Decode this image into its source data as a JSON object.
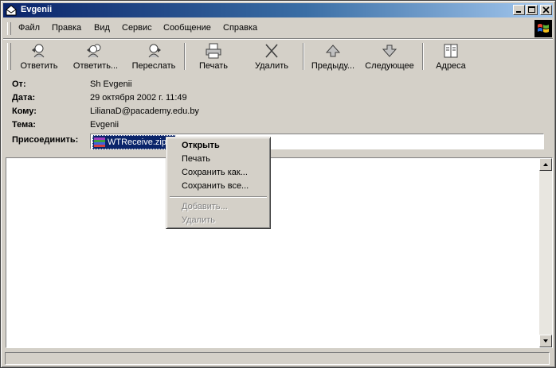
{
  "window": {
    "title": "Evgenii"
  },
  "menu": [
    "Файл",
    "Правка",
    "Вид",
    "Сервис",
    "Сообщение",
    "Справка"
  ],
  "toolbar": [
    {
      "label": "Ответить",
      "icon": "reply-icon"
    },
    {
      "label": "Ответить...",
      "icon": "reply-all-icon"
    },
    {
      "label": "Переслать",
      "icon": "forward-icon"
    },
    {
      "label": "Печать",
      "icon": "print-icon"
    },
    {
      "label": "Удалить",
      "icon": "delete-icon"
    },
    {
      "label": "Предыду...",
      "icon": "previous-icon"
    },
    {
      "label": "Следующее",
      "icon": "next-icon"
    },
    {
      "label": "Адреса",
      "icon": "address-book-icon"
    }
  ],
  "headers": {
    "from": {
      "label": "От:",
      "value": "Sh Evgenii"
    },
    "date": {
      "label": "Дата:",
      "value": "29 октября 2002 г. 11:49"
    },
    "to": {
      "label": "Кому:",
      "value": "LilianaD@pacademy.edu.by"
    },
    "subject": {
      "label": "Тема:",
      "value": "Evgenii"
    },
    "attach": {
      "label": "Присоединить:",
      "file": "WTReceive.zip ("
    }
  },
  "context_menu": [
    {
      "label": "Открыть",
      "default": true,
      "disabled": false
    },
    {
      "label": "Печать",
      "default": false,
      "disabled": false
    },
    {
      "label": "Сохранить как...",
      "default": false,
      "disabled": false
    },
    {
      "label": "Сохранить все...",
      "default": false,
      "disabled": false
    },
    {
      "label": "Добавить...",
      "default": false,
      "disabled": true
    },
    {
      "label": "Удалить",
      "default": false,
      "disabled": true
    }
  ],
  "colors": {
    "title_start": "#0a246a",
    "title_end": "#a6caf0",
    "face": "#d4d0c8",
    "selection": "#0a246a"
  }
}
